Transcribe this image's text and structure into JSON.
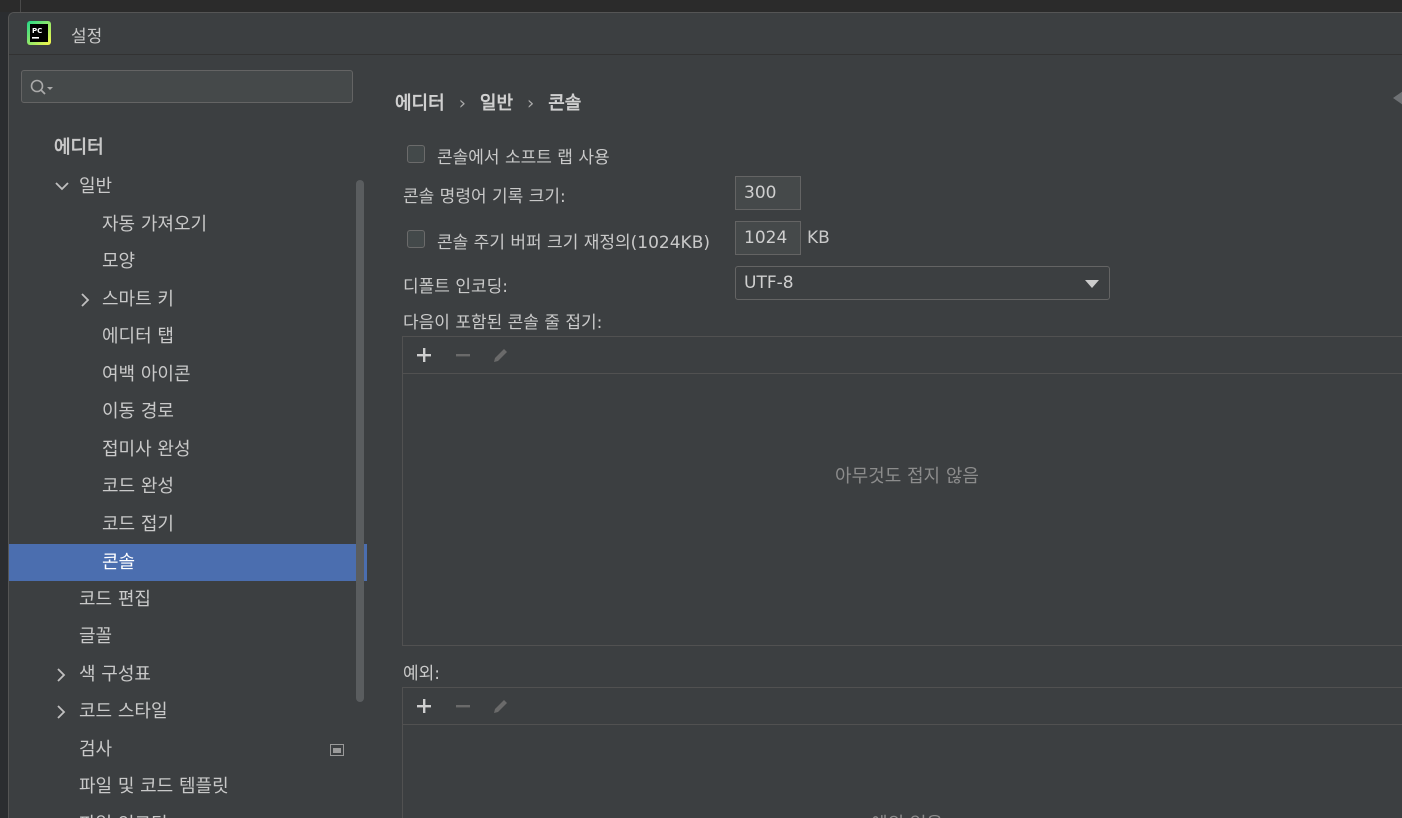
{
  "window": {
    "title": "설정"
  },
  "sidebar": {
    "items": [
      {
        "label": "에디터"
      },
      {
        "label": "일반"
      },
      {
        "label": "자동 가져오기"
      },
      {
        "label": "모양"
      },
      {
        "label": "스마트 키"
      },
      {
        "label": "에디터 탭"
      },
      {
        "label": "여백 아이콘"
      },
      {
        "label": "이동 경로"
      },
      {
        "label": "접미사 완성"
      },
      {
        "label": "코드 완성"
      },
      {
        "label": "코드 접기"
      },
      {
        "label": "콘솔"
      },
      {
        "label": "코드 편집"
      },
      {
        "label": "글꼴"
      },
      {
        "label": "색 구성표"
      },
      {
        "label": "코드 스타일"
      },
      {
        "label": "검사"
      },
      {
        "label": "파일 및 코드 템플릿"
      },
      {
        "label": "파일 인코딩"
      }
    ]
  },
  "breadcrumb": {
    "part1": "에디터",
    "part2": "일반",
    "part3": "콘솔",
    "separator": "›"
  },
  "settings": {
    "soft_wrap_label": "콘솔에서 소프트 랩 사용",
    "history_label": "콘솔 명령어 기록 크기:",
    "history_value": "300",
    "buffer_label": "콘솔 주기 버퍼 크기 재정의(1024KB)",
    "buffer_value": "1024",
    "buffer_unit": "KB",
    "encoding_label": "디폴트 인코딩:",
    "encoding_value": "UTF-8",
    "fold_label": "다음이 포함된 콘솔 줄 접기:",
    "fold_empty": "아무것도 접지 않음",
    "exceptions_label": "예외:",
    "exceptions_empty": "예외 없음"
  },
  "icons": {
    "search": "search-icon",
    "add": "plus-icon",
    "remove": "minus-icon",
    "edit": "pencil-icon",
    "project": "project-scope-icon",
    "app": "pycharm-icon"
  },
  "colors": {
    "selection": "#4b6eaf",
    "background": "#3c3f41"
  }
}
